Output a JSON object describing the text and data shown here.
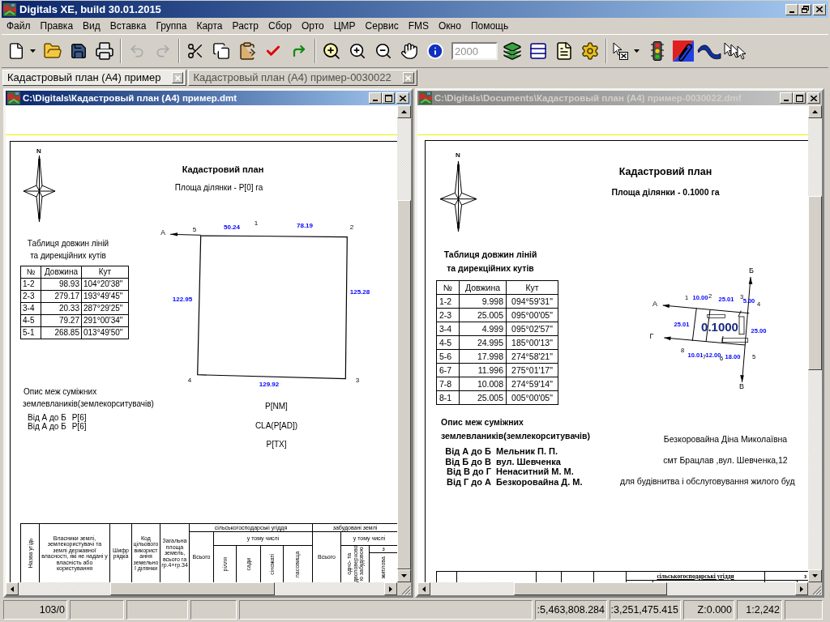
{
  "window": {
    "title": "Digitals XE, build 30.01.2015"
  },
  "menu": [
    "Файл",
    "Правка",
    "Вид",
    "Вставка",
    "Группа",
    "Карта",
    "Растр",
    "Сбор",
    "Орто",
    "ЦМР",
    "Сервис",
    "FMS",
    "Окно",
    "Помощь"
  ],
  "toolbar": {
    "undo": {
      "disabled": true
    },
    "redo": {
      "disabled": true
    },
    "scale": {
      "value": "2000",
      "disabled": true
    }
  },
  "document_tabs": [
    {
      "label": "Кадастровый план (А4) пример",
      "selected": true
    },
    {
      "label": "Кадастровый план (А4) пример-0030022",
      "selected": false
    }
  ],
  "documents": [
    {
      "kind": "template",
      "title": "C:\\Digitals\\Кадастровый план (А4) пример.dmt",
      "active": true,
      "north_label": "N",
      "heading": "Кадастровий план",
      "area": "Площа ділянки - P[0] га",
      "table_caption": [
        "Таблиця довжин ліній",
        "та дирекційних кутів"
      ],
      "table": {
        "columns": [
          "№",
          "Довжина",
          "Кут"
        ],
        "rows": [
          [
            "1-2",
            "98.93",
            "104°20'38\""
          ],
          [
            "2-3",
            "279.17",
            "193°49'45\""
          ],
          [
            "3-4",
            "20.33",
            "287°29'25\""
          ],
          [
            "4-5",
            "79.27",
            "291°00'34\""
          ],
          [
            "5-1",
            "268.85",
            "013°49'50\""
          ]
        ]
      },
      "plot": {
        "directions": [
          "А"
        ],
        "points": [
          "5",
          "1",
          "2",
          "4",
          "3"
        ],
        "lengths": [
          "50.24",
          "78.19",
          "122.95",
          "125.28",
          "129.92"
        ]
      },
      "neighbours_caption": [
        "Опис меж суміжних",
        "землевлаників(землекорситувачів)"
      ],
      "neighbours": [
        {
          "segment": "Від А до Б",
          "name": "P[6]"
        },
        {
          "segment": "Від А до Б",
          "name": "P[6]"
        }
      ],
      "fields": [
        "P[NM]",
        "CLA(P[AD])",
        "P[TX]"
      ],
      "land_table": {
        "headers": [
          "Назва угідь",
          "Власники землі, землекористувачі та землі державної власності, які не надані у власність або користування",
          "Шифр рядка",
          "Код цільового використання земельної ділянки",
          "Загальна площа земель, всього га гр.4+гр.34",
          "сільськогосподарські угіддя",
          "Всього",
          "у тому числі",
          "рілля",
          "сади",
          "сіножаті",
          "пасовища",
          "забудовані землі",
          "Всього",
          "у тому числі",
          "одно- та двоповерховою забудовою",
          "з",
          "житлова"
        ]
      }
    },
    {
      "kind": "filled",
      "title": "C:\\Digitals\\Documents\\Кадастровый план (А4) пример-0030022.dmf",
      "active": false,
      "north_label": "N",
      "heading": "Кадастровий план",
      "area": "Площа ділянки - 0.1000 га",
      "table_caption": [
        "Таблиця довжин ліній",
        "та дирекційних кутів"
      ],
      "table": {
        "columns": [
          "№",
          "Довжина",
          "Кут"
        ],
        "rows": [
          [
            "1-2",
            "9.998",
            "094°59'31\""
          ],
          [
            "2-3",
            "25.005",
            "095°00'05\""
          ],
          [
            "3-4",
            "4.999",
            "095°02'57\""
          ],
          [
            "4-5",
            "24.995",
            "185°00'13\""
          ],
          [
            "5-6",
            "17.998",
            "274°58'21\""
          ],
          [
            "6-7",
            "11.996",
            "275°01'17\""
          ],
          [
            "7-8",
            "10.008",
            "274°59'14\""
          ],
          [
            "8-1",
            "25.005",
            "005°00'05\""
          ]
        ]
      },
      "plot": {
        "directions": [
          "Б",
          "А",
          "Г",
          "В"
        ],
        "points": [
          "1",
          "2",
          "3",
          "4",
          "8",
          "7",
          "6",
          "5"
        ],
        "lengths": [
          "10.00",
          "25.01",
          "5.00",
          "25.01",
          "25.00",
          "10.01",
          "12.00",
          "18.00"
        ],
        "area": "0.1000"
      },
      "neighbours_caption": [
        "Опис меж суміжних",
        "землевлаників(землекорситувачів)"
      ],
      "neighbours": [
        {
          "segment": "Від А до Б",
          "name": "Мельник П. П."
        },
        {
          "segment": "Від Б до В",
          "name": "вул. Шевченка"
        },
        {
          "segment": "Від В до Г",
          "name": "Ненаситний М. М."
        },
        {
          "segment": "Від Г до А",
          "name": "Безкоровайна Д. М."
        }
      ],
      "owner": [
        "Безкоровайна Діна Миколаївна",
        "смт Брацлав ,вул. Шевченка,12",
        "для будівнитва і обслуговування жилого буд"
      ],
      "land_table": {
        "headers": [
          "сільськогосподарські угіддя",
          "з"
        ]
      }
    }
  ],
  "status_bar": {
    "record": "103/0",
    "x": ":5,463,808.284",
    "y": ":3,251,475.415",
    "z": "Z:0.000",
    "scale": "1:2,242"
  }
}
